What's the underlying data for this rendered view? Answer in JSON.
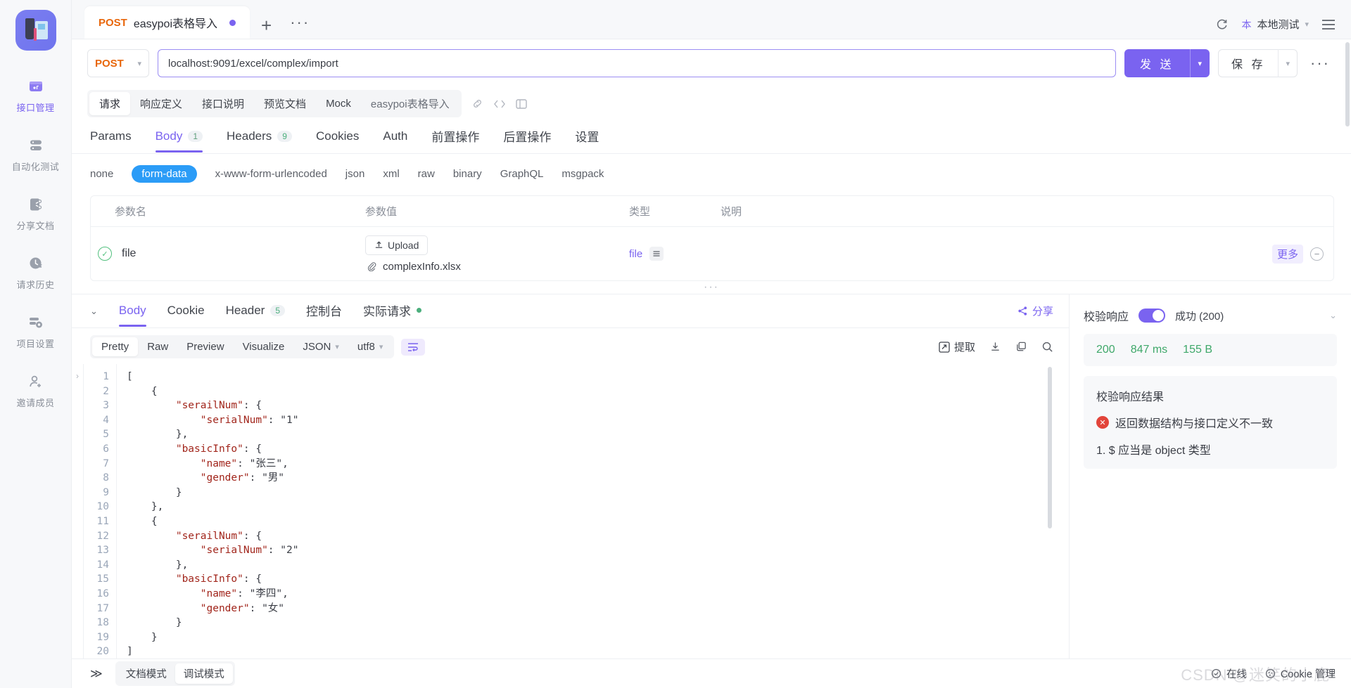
{
  "sidebar": {
    "logo_name": "app-logo",
    "items": [
      {
        "label": "接口管理",
        "icon": "api-manage-icon",
        "active": true
      },
      {
        "label": "自动化测试",
        "icon": "automation-test-icon",
        "active": false
      },
      {
        "label": "分享文档",
        "icon": "share-doc-icon",
        "active": false
      },
      {
        "label": "请求历史",
        "icon": "history-clock-icon",
        "active": false
      },
      {
        "label": "项目设置",
        "icon": "project-settings-icon",
        "active": false
      },
      {
        "label": "邀请成员",
        "icon": "invite-member-icon",
        "active": false
      }
    ]
  },
  "tabstrip": {
    "tab_method": "POST",
    "tab_title": "easypoi表格导入",
    "new_tab": "+",
    "more_tabs": "···",
    "refresh_icon": "refresh-icon",
    "env_badge": "本",
    "env_name": "本地测试",
    "menu_icon": "hamburger-menu-icon"
  },
  "urlbar": {
    "method": "POST",
    "url": "localhost:9091/excel/complex/import",
    "send_label": "发 送",
    "save_label": "保 存",
    "more": "···"
  },
  "subtabs": {
    "items": [
      {
        "label": "请求",
        "active": true
      },
      {
        "label": "响应定义",
        "active": false
      },
      {
        "label": "接口说明",
        "active": false
      },
      {
        "label": "预览文档",
        "active": false
      },
      {
        "label": "Mock",
        "active": false
      },
      {
        "label": "easypoi表格导入",
        "active": false
      }
    ],
    "icons": [
      "link-icon",
      "code-icon",
      "panel-icon"
    ]
  },
  "request_tabs": [
    {
      "label": "Params",
      "count": "",
      "active": false
    },
    {
      "label": "Body",
      "count": "1",
      "active": true
    },
    {
      "label": "Headers",
      "count": "9",
      "active": false
    },
    {
      "label": "Cookies",
      "count": "",
      "active": false
    },
    {
      "label": "Auth",
      "count": "",
      "active": false
    },
    {
      "label": "前置操作",
      "count": "",
      "active": false
    },
    {
      "label": "后置操作",
      "count": "",
      "active": false
    },
    {
      "label": "设置",
      "count": "",
      "active": false
    }
  ],
  "body_types": [
    {
      "label": "none",
      "active": false
    },
    {
      "label": "form-data",
      "active": true
    },
    {
      "label": "x-www-form-urlencoded",
      "active": false
    },
    {
      "label": "json",
      "active": false
    },
    {
      "label": "xml",
      "active": false
    },
    {
      "label": "raw",
      "active": false
    },
    {
      "label": "binary",
      "active": false
    },
    {
      "label": "GraphQL",
      "active": false
    },
    {
      "label": "msgpack",
      "active": false
    }
  ],
  "params_table": {
    "headers": {
      "name": "参数名",
      "value": "参数值",
      "type": "类型",
      "desc": "说明"
    },
    "rows": [
      {
        "enabled": true,
        "name": "file",
        "upload_label": "Upload",
        "file_name": "complexInfo.xlsx",
        "type": "file",
        "desc": "",
        "more_label": "更多"
      }
    ]
  },
  "response": {
    "tabs": [
      {
        "label": "Body",
        "count": "",
        "active": true
      },
      {
        "label": "Cookie",
        "count": "",
        "active": false
      },
      {
        "label": "Header",
        "count": "5",
        "active": false
      },
      {
        "label": "控制台",
        "count": "",
        "active": false
      },
      {
        "label": "实际请求",
        "count": "",
        "active": false,
        "dot": true
      }
    ],
    "share_label": "分享",
    "view_tabs": [
      {
        "label": "Pretty",
        "active": true
      },
      {
        "label": "Raw",
        "active": false
      },
      {
        "label": "Preview",
        "active": false
      },
      {
        "label": "Visualize",
        "active": false
      }
    ],
    "format_select": "JSON",
    "encoding_select": "utf8",
    "wrap_icon": "wrap-lines-icon",
    "extract_label": "提取",
    "toolbar_icons": [
      "download-icon",
      "copy-icon",
      "search-icon"
    ],
    "code_lines": [
      {
        "n": "1",
        "text": "["
      },
      {
        "n": "2",
        "text": "    {"
      },
      {
        "n": "3",
        "text": "        \"serailNum\": {"
      },
      {
        "n": "4",
        "text": "            \"serialNum\": \"1\""
      },
      {
        "n": "5",
        "text": "        },"
      },
      {
        "n": "6",
        "text": "        \"basicInfo\": {"
      },
      {
        "n": "7",
        "text": "            \"name\": \"张三\","
      },
      {
        "n": "8",
        "text": "            \"gender\": \"男\""
      },
      {
        "n": "9",
        "text": "        }"
      },
      {
        "n": "10",
        "text": "    },"
      },
      {
        "n": "11",
        "text": "    {"
      },
      {
        "n": "12",
        "text": "        \"serailNum\": {"
      },
      {
        "n": "13",
        "text": "            \"serialNum\": \"2\""
      },
      {
        "n": "14",
        "text": "        },"
      },
      {
        "n": "15",
        "text": "        \"basicInfo\": {"
      },
      {
        "n": "16",
        "text": "            \"name\": \"李四\","
      },
      {
        "n": "17",
        "text": "            \"gender\": \"女\""
      },
      {
        "n": "18",
        "text": "        }"
      },
      {
        "n": "19",
        "text": "    }"
      },
      {
        "n": "20",
        "text": "]"
      }
    ]
  },
  "validation": {
    "title": "校验响应",
    "toggle_on": true,
    "status": "成功 (200)",
    "stats": {
      "code": "200",
      "time": "847 ms",
      "size": "155 B"
    },
    "result_title": "校验响应结果",
    "error_summary": "返回数据结构与接口定义不一致",
    "error_items": [
      "1. $ 应当是 object 类型"
    ]
  },
  "statusbar": {
    "expand": "≫",
    "modes": [
      {
        "label": "文档模式",
        "active": false
      },
      {
        "label": "调试模式",
        "active": true
      }
    ],
    "online_label": "在线",
    "cookie_label": "Cookie 管理",
    "watermark": "CSDN @迷笑的小鹿"
  },
  "colors": {
    "accent": "#7a63f0",
    "method": "#e8670c",
    "success": "#3fa86a",
    "error": "#e2443a",
    "formdata": "#2b9cf7"
  }
}
